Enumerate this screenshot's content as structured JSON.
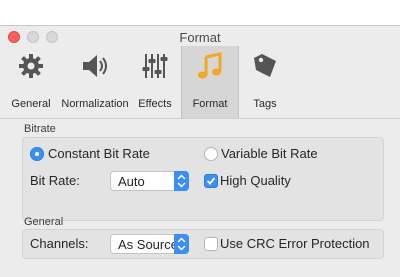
{
  "window": {
    "title": "Format"
  },
  "toolbar": {
    "items": [
      {
        "label": "General",
        "icon": "gear-icon"
      },
      {
        "label": "Normalization",
        "icon": "speaker-icon"
      },
      {
        "label": "Effects",
        "icon": "sliders-icon"
      },
      {
        "label": "Format",
        "icon": "music-note-icon",
        "selected": true
      },
      {
        "label": "Tags",
        "icon": "tag-icon"
      }
    ]
  },
  "bitrate": {
    "section_label": "Bitrate",
    "constant_label": "Constant Bit Rate",
    "variable_label": "Variable Bit Rate",
    "mode": "constant",
    "rate_label": "Bit Rate:",
    "rate_value": "Auto",
    "high_quality_label": "High Quality",
    "high_quality_checked": true
  },
  "general": {
    "section_label": "General",
    "channels_label": "Channels:",
    "channels_value": "As Source",
    "crc_label": "Use CRC Error Protection",
    "crc_checked": false
  },
  "colors": {
    "accent": "#3b8ff4",
    "close": "#fc605c",
    "note": "#f5a623"
  }
}
